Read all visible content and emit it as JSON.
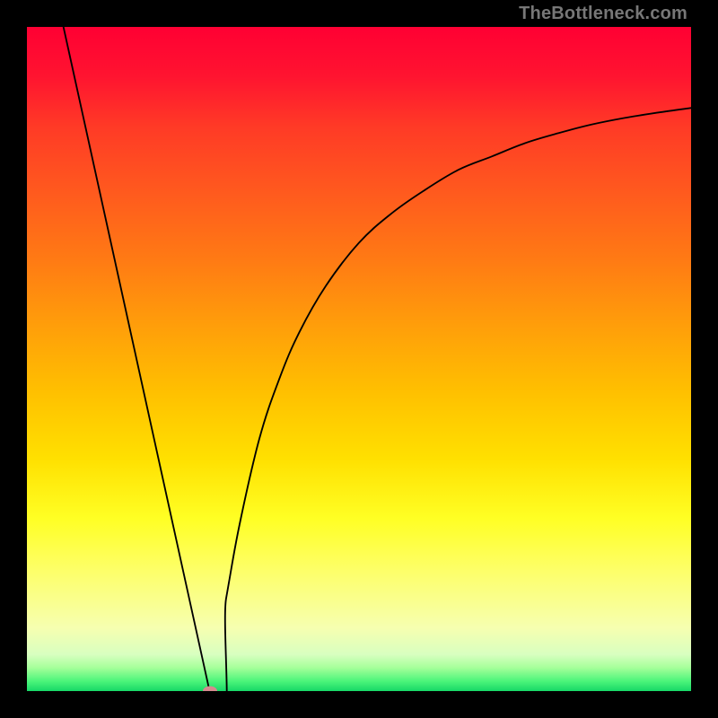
{
  "watermark": "TheBottleneck.com",
  "colors": {
    "black": "#000000",
    "curve": "#000000",
    "marker": "#d68a8f",
    "watermark_text": "#777777",
    "gradient_stops": [
      {
        "offset": 0.0,
        "color": "#ff0033"
      },
      {
        "offset": 0.075,
        "color": "#ff1430"
      },
      {
        "offset": 0.15,
        "color": "#ff3a26"
      },
      {
        "offset": 0.25,
        "color": "#ff5a1e"
      },
      {
        "offset": 0.35,
        "color": "#ff7a14"
      },
      {
        "offset": 0.45,
        "color": "#ff9e0a"
      },
      {
        "offset": 0.55,
        "color": "#ffc000"
      },
      {
        "offset": 0.65,
        "color": "#ffe000"
      },
      {
        "offset": 0.74,
        "color": "#ffff24"
      },
      {
        "offset": 0.82,
        "color": "#fdff6a"
      },
      {
        "offset": 0.905,
        "color": "#f6ffb0"
      },
      {
        "offset": 0.945,
        "color": "#d8ffc0"
      },
      {
        "offset": 0.965,
        "color": "#a5ff9a"
      },
      {
        "offset": 0.985,
        "color": "#4cf57a"
      },
      {
        "offset": 1.0,
        "color": "#17d867"
      }
    ]
  },
  "chart_data": {
    "type": "line",
    "title": "",
    "xlabel": "",
    "ylabel": "",
    "x_range": [
      0,
      100
    ],
    "y_range": [
      0,
      100
    ],
    "grid": false,
    "legend_position": "none",
    "background": "vertical-gradient",
    "marker": {
      "x": 27.5,
      "y": 0.0,
      "shape": "oval",
      "color": "#d68a8f"
    },
    "series": [
      {
        "name": "left-descending-line",
        "segment": "linear",
        "x": [
          5.5,
          27.5
        ],
        "y": [
          100,
          0.0
        ]
      },
      {
        "name": "right-rising-curve",
        "segment": "concave-increasing",
        "x": [
          27.5,
          30,
          32,
          35,
          38,
          41,
          45,
          50,
          55,
          60,
          65,
          70,
          75,
          80,
          85,
          90,
          95,
          100
        ],
        "y": [
          0.0,
          14,
          25,
          38,
          47,
          54,
          61,
          67.5,
          72,
          75.5,
          78.5,
          80.5,
          82.5,
          84,
          85.3,
          86.3,
          87.1,
          87.8
        ]
      }
    ],
    "notes": "y-axis shown inverted in image (higher y values drawn nearer the top of the gradient panel); values here are on the logical 0–100 scale with 0 at the bottom of the plotted curve minimum."
  }
}
